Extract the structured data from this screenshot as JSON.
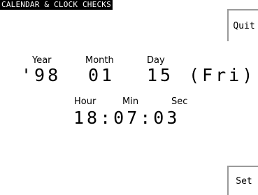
{
  "screen": {
    "title": "CALENDAR & CLOCK CHECKS"
  },
  "buttons": {
    "quit": "Quit",
    "set": "Set"
  },
  "date": {
    "year_label": "Year",
    "month_label": "Month",
    "day_label": "Day",
    "year": "'98",
    "month": "01",
    "day": "15",
    "weekday": "(Fri)"
  },
  "time": {
    "hour_label": "Hour",
    "min_label": "Min",
    "sec_label": "Sec",
    "value": "18:07:03"
  }
}
